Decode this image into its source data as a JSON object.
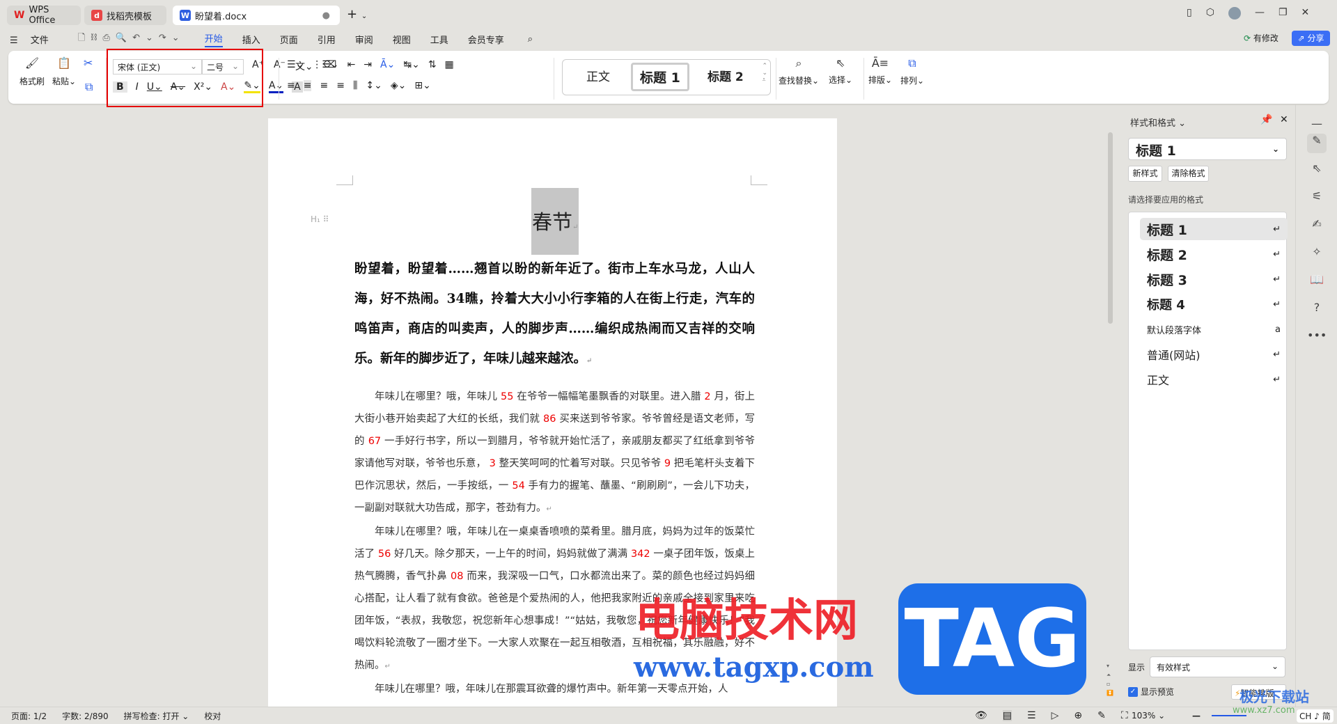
{
  "tabs": [
    {
      "label": "WPS Office"
    },
    {
      "label": "找稻壳模板"
    },
    {
      "label": "盼望着.docx"
    }
  ],
  "menu": {
    "file": "文件",
    "items": [
      "开始",
      "插入",
      "页面",
      "引用",
      "审阅",
      "视图",
      "工具",
      "会员专享"
    ],
    "modified": "有修改",
    "share": "分享"
  },
  "ribbon": {
    "format_painter": "格式刷",
    "paste": "粘贴",
    "font": "宋体 (正文)",
    "size": "二号",
    "styles": [
      "正文",
      "标题 1",
      "标题 2"
    ],
    "find_replace": "查找替换",
    "select": "选择",
    "layout": "排版",
    "arrange": "排列"
  },
  "document": {
    "heading": "春节",
    "lead": "盼望着，盼望着……翘首以盼的新年近了。街市上车水马龙，人山人海，好不热闹。34瞧，拎着大大小小行李箱的人在街上行走，汽车的鸣笛声，商店的叫卖声，人的脚步声……编织成热闹而又吉祥的交响乐。新年的脚步近了，年味儿越来越浓。",
    "p1": [
      "年味儿在哪里？哦，年味儿",
      "55",
      "在爷爷一幅幅笔墨飘香的对联里。进入腊",
      "2",
      "月，街上大街小巷开始卖起了大红的长纸，我们就",
      "86",
      "买来送到爷爷家。爷爷曾经是语文老师，写的",
      "67",
      "一手好行书字，所以一到腊月，爷爷就开始忙活了，亲戚朋友都买了红纸拿到爷爷家请他写对联，爷爷也乐意，",
      "3",
      "整天笑呵呵的忙着写对联。只见爷爷",
      "9",
      "把毛笔杆头支着下巴作沉思状，然后，一手按纸，一",
      "54",
      "手有力的握笔、蘸墨、“刷刷刷”，一会儿下功夫，一副副对联就大功告成，那字，苍劲有力。"
    ],
    "p2": [
      "年味儿在哪里？哦，年味儿在一桌桌香喷喷的菜肴里。腊月底，妈妈为过年的饭菜忙活了",
      "56",
      "好几天。除夕那天，一上午的时间，妈妈就做了满满",
      "342",
      "一桌子团年饭，饭桌上热气腾腾，香气扑鼻",
      "08",
      "而来，我深吸一口气，口水都流出来了。菜的颜色也经过妈妈细心搭配，让人看了就有食欲。爸爸是个爱热闹的人，他把我家附近的亲戚全接到家里来吃团年饭，“表叔，我敬您，祝您新年心想事成！”“姑姑，我敬您，祝您新年健康快乐！”我喝饮料轮流敬了一圈才坐下。一大家人欢聚在一起互相敬酒，互相祝福，其乐融融，好不热闹。"
    ],
    "p3": "年味儿在哪里？哦，年味儿在那震耳欲聋的爆竹声中。新年第一天零点开始，人"
  },
  "panel": {
    "title": "样式和格式",
    "current": "标题 1",
    "new_style": "新样式",
    "clear_format": "清除格式",
    "prompt": "请选择要应用的格式",
    "styles": [
      "标题 1",
      "标题 2",
      "标题 3",
      "标题 4",
      "默认段落字体",
      "普通(网站)",
      "正文"
    ],
    "show_label": "显示",
    "show_value": "有效样式",
    "preview": "显示预览",
    "smart_layout": "智能排版"
  },
  "status": {
    "page": "页面: 1/2",
    "words": "字数: 2/890",
    "spell": "拼写检查: 打开",
    "proof": "校对",
    "zoom": "103%",
    "ime": "CH ♪ 简"
  },
  "watermarks": {
    "cn": "电脑技术网",
    "url": "www.tagxp.com",
    "tag": "TAG",
    "site": "极光下载站",
    "site_url": "www.xz7.com"
  },
  "colors": {
    "accent": "#2459e6",
    "highlight": "#e60000"
  }
}
